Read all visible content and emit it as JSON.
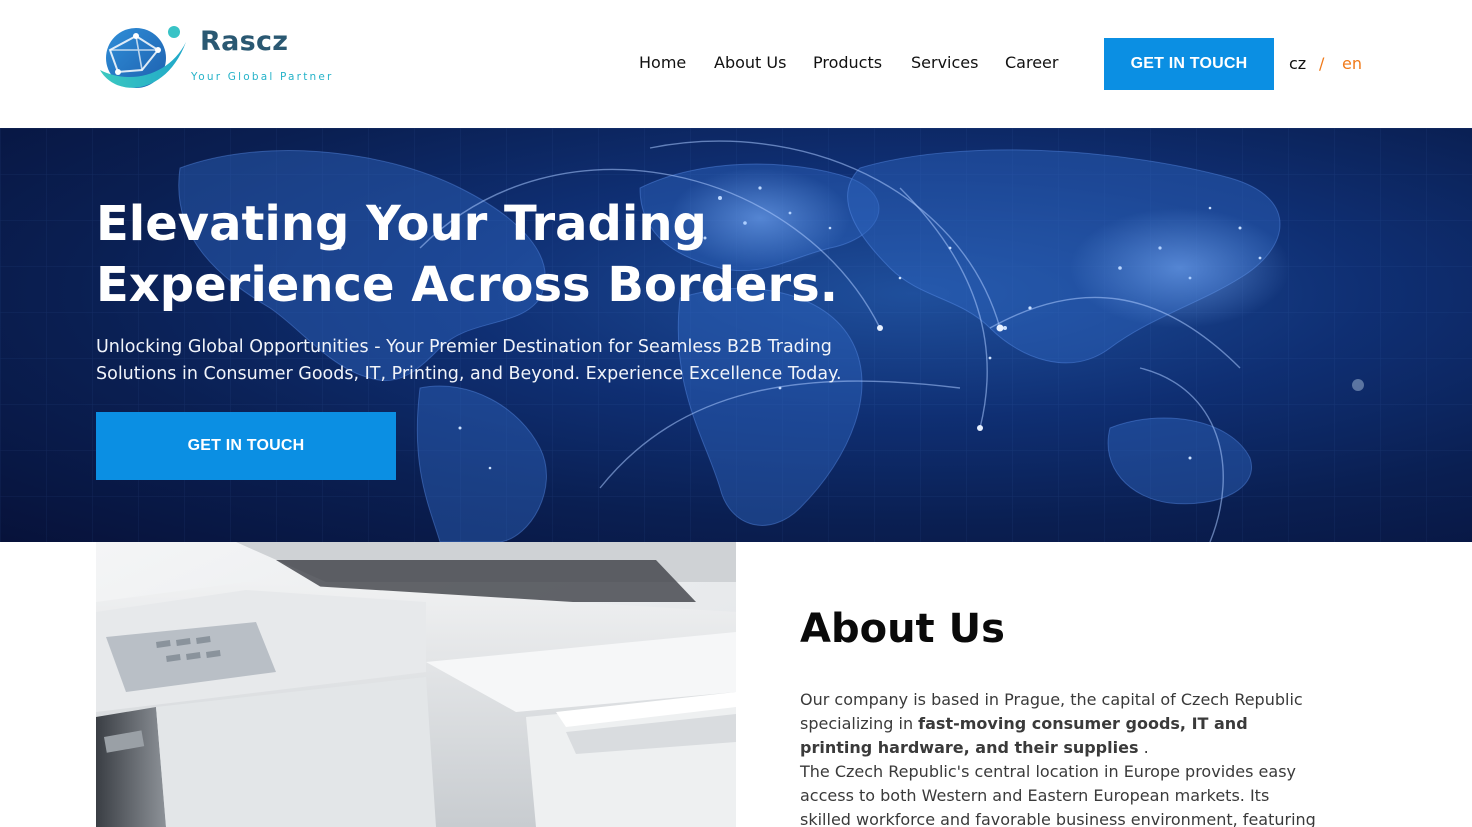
{
  "brand": {
    "name": "Rascz",
    "tagline": "Your Global Partner",
    "colors": {
      "primary": "#0b8fe3",
      "accent": "#f07a1a",
      "logo_blue": "#2a5872",
      "logo_teal": "#26b3c9"
    }
  },
  "nav": {
    "items": [
      {
        "label": "Home"
      },
      {
        "label": "About Us"
      },
      {
        "label": "Products"
      },
      {
        "label": "Services"
      },
      {
        "label": "Career"
      }
    ],
    "cta_label": "GET IN TOUCH"
  },
  "language": {
    "cz": "cz",
    "separator": "/",
    "en": "en",
    "active": "en"
  },
  "hero": {
    "title_line1": "Elevating Your Trading",
    "title_line2": "Experience Across Borders.",
    "subtitle_line1": "Unlocking Global Opportunities - Your Premier Destination for Seamless B2B Trading",
    "subtitle_line2": "Solutions in Consumer Goods, IT, Printing, and Beyond. Experience Excellence Today.",
    "cta_label": "GET IN TOUCH",
    "background": "world-map-network-image"
  },
  "about": {
    "title": "About Us",
    "p1_start": "Our company is based in Prague, the capital of Czech Republic specializing in ",
    "p1_bold": "fast-moving consumer goods, IT and printing hardware, and their supplies",
    "p1_end": " .",
    "p2": "The Czech Republic's central location in Europe provides easy access to both Western and Eastern European markets. Its skilled workforce and favorable business environment, featuring",
    "image": "printer-photo"
  }
}
